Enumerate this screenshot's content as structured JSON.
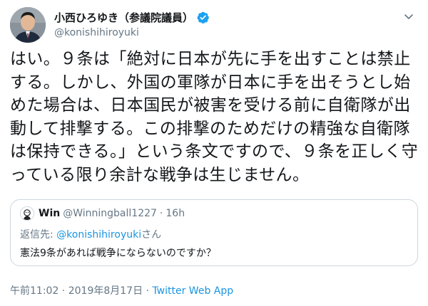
{
  "author": {
    "display_name": "小西ひろゆき（参議院議員）",
    "handle": "@konishihiroyuki",
    "verified_icon": "verified-badge-icon",
    "accent": "#1da1f2"
  },
  "tweet": {
    "text": "はい。９条は「絶対に日本が先に手を出すことは禁止する。しかし、外国の軍隊が日本に手を出そうとし始めた場合は、日本国民が被害を受ける前に自衛隊が出動して排撃する。この排撃のためだけの精強な自衛隊は保持できる。」という条文ですので、９条を正しく守っている限り余計な戦争は生じません。"
  },
  "quoted": {
    "name": "Win",
    "handle": "@Winningball1227",
    "separator": "·",
    "time": "16h",
    "reply_prefix": "返信先: ",
    "reply_mention": "@konishihiroyuki",
    "reply_suffix": "さん",
    "text": "憲法9条があれば戦争にならないのですか？"
  },
  "meta": {
    "time": "午前11:02",
    "separator1": " · ",
    "date": "2019年8月17日",
    "separator2": " · ",
    "source": "Twitter Web App"
  },
  "colors": {
    "text": "#14171a",
    "secondary": "#657786",
    "link": "#1b95e0",
    "border": "#ccd6dd"
  }
}
